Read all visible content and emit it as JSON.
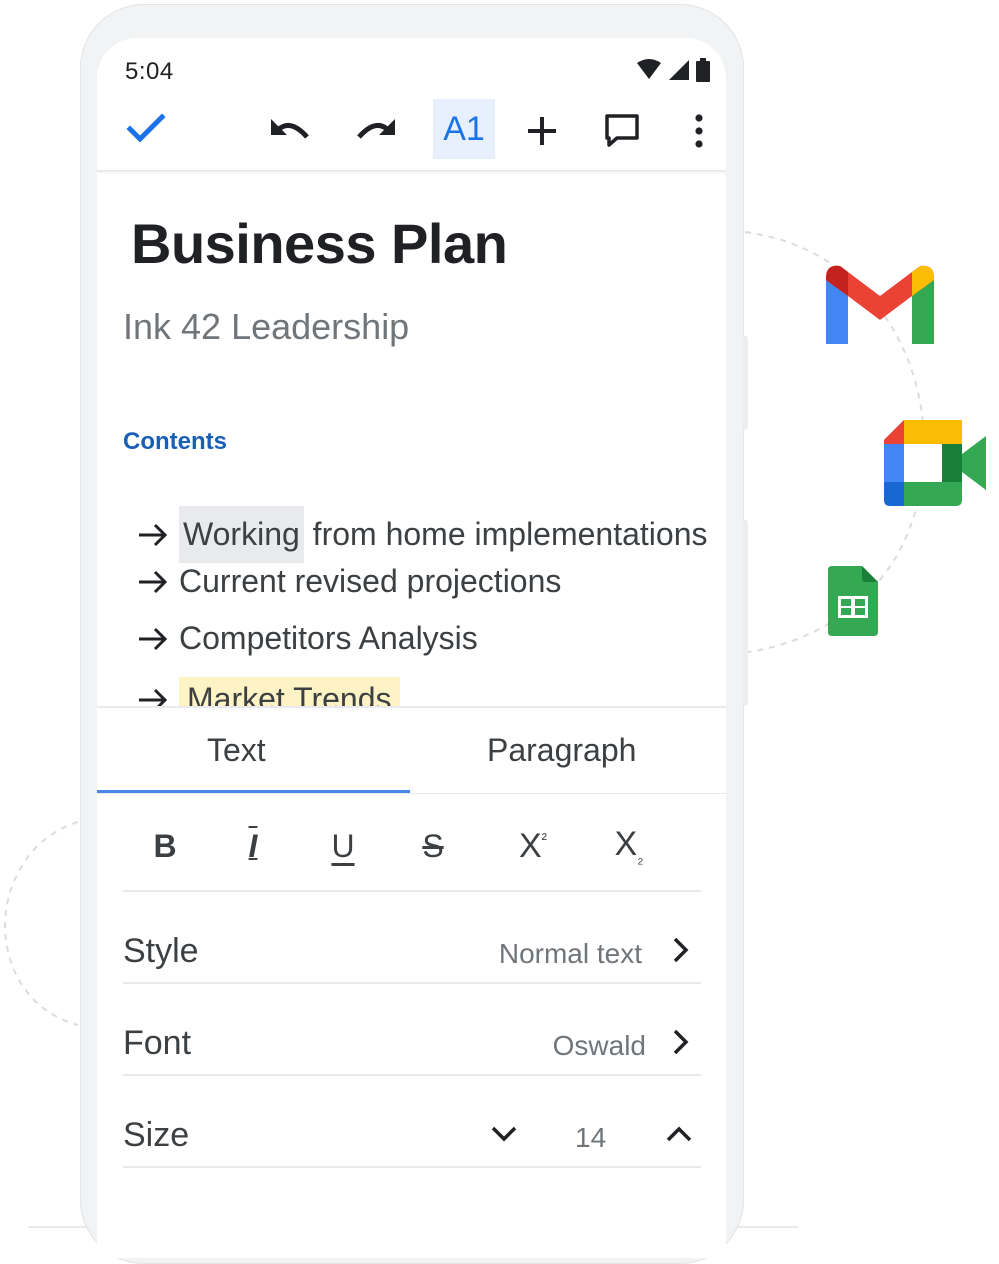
{
  "status_bar": {
    "time": "5:04"
  },
  "toolbar": {
    "format_label": "A1"
  },
  "document": {
    "title": "Business Plan",
    "subtitle": "Ink 42 Leadership",
    "contents_heading": "Contents",
    "toc": [
      {
        "text_highlight": "Working",
        "text_rest": " from home implementations"
      },
      {
        "text": "Current revised projections"
      },
      {
        "text": "Competitors Analysis"
      },
      {
        "text": "Market Trends"
      }
    ]
  },
  "format_panel": {
    "tabs": [
      {
        "label": "Text",
        "selected": true
      },
      {
        "label": "Paragraph",
        "selected": false
      }
    ],
    "text_buttons": {
      "bold": "B",
      "italic": "I",
      "underline": "U",
      "strikethrough": "S",
      "superscript_base": "X",
      "superscript_mark": "²",
      "subscript_base": "X",
      "subscript_mark": "₂"
    },
    "style": {
      "label": "Style",
      "value": "Normal text"
    },
    "font": {
      "label": "Font",
      "value": "Oswald"
    },
    "size": {
      "label": "Size",
      "value": "14"
    }
  },
  "colors": {
    "accent": "#1a73e8",
    "highlight_gray": "#e8eaed",
    "highlight_yellow": "#fdf3c4",
    "gmail_red": "#ea4335",
    "google_blue": "#4285f4",
    "google_green": "#34a853",
    "google_yellow": "#fbbc04"
  },
  "app_icons": [
    "gmail-icon",
    "google-meet-icon",
    "google-sheets-icon"
  ]
}
